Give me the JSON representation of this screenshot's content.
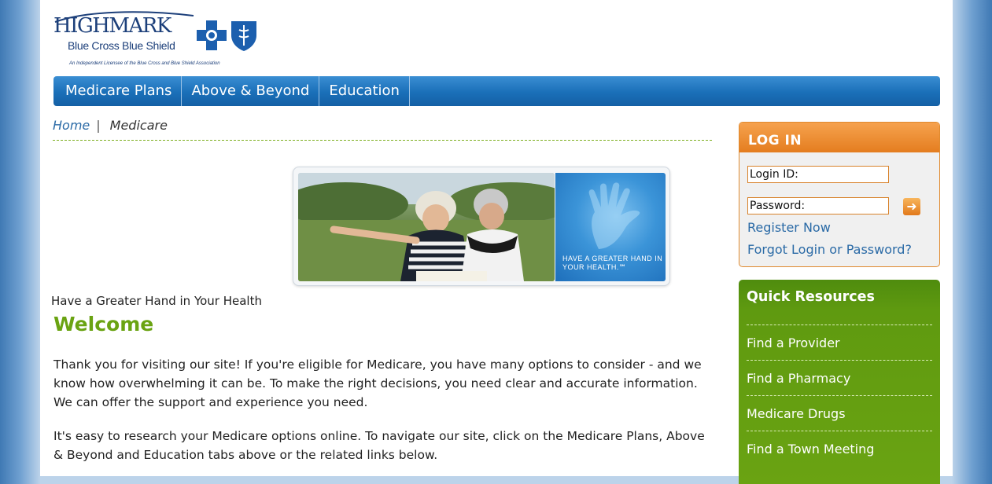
{
  "brand": {
    "name": "HIGHMARK",
    "sub": "Blue Cross Blue Shield",
    "tagline": "An Independent Licensee of the Blue Cross and Blue Shield Association"
  },
  "nav": {
    "items": [
      "Medicare Plans",
      "Above & Beyond",
      "Education"
    ]
  },
  "breadcrumb": {
    "home": "Home",
    "current": "Medicare"
  },
  "hero": {
    "panel_text": "HAVE A GREATER HAND IN YOUR HEALTH.℠"
  },
  "main": {
    "caption": "Have a Greater Hand in Your Health",
    "welcome": "Welcome",
    "para1": "Thank you for visiting our site! If you're eligible for Medicare, you have many options to consider - and we know how overwhelming it can be. To make the right decisions, you need clear and accurate information. We can offer the support and experience you need.",
    "para2": "It's easy to research your Medicare options online. To navigate our site, click on the Medicare Plans, Above & Beyond and Education tabs above or the related links below."
  },
  "login": {
    "title": "LOG IN",
    "login_id_value": "Login ID:",
    "password_value": "Password:",
    "register": "Register Now",
    "forgot": "Forgot Login or Password?"
  },
  "quick": {
    "title": "Quick Resources",
    "items": [
      "Find a Provider",
      "Find a Pharmacy",
      "Medicare Drugs",
      "Find a Town Meeting"
    ]
  },
  "colors": {
    "nav_blue": "#1a6fb8",
    "login_orange": "#e47d1f",
    "quick_green": "#6aa312",
    "link_blue": "#2a6aa6",
    "welcome_green": "#6aa312"
  }
}
